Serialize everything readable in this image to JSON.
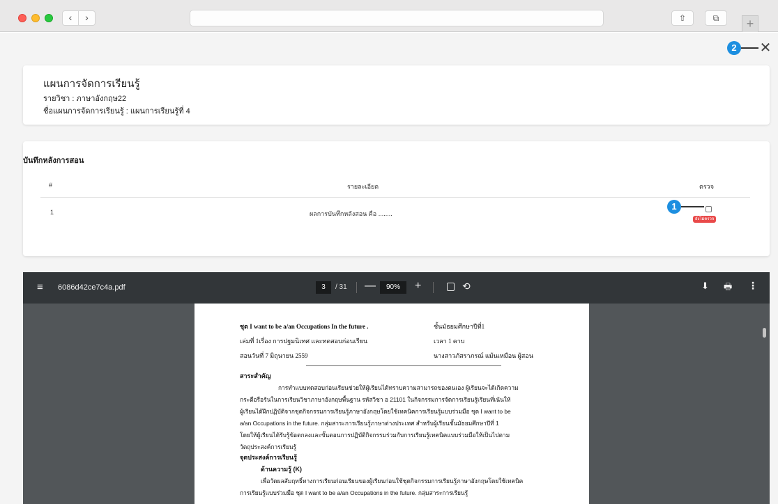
{
  "browser": {
    "url": "",
    "back_icon": "‹",
    "forward_icon": "›",
    "share_icon": "⇧",
    "tabs_icon": "⧉",
    "newtab_icon": "+"
  },
  "callouts": {
    "one": "1",
    "two": "2"
  },
  "close_icon": "✕",
  "plan_card": {
    "title": "แผนการจัดการเรียนรู้",
    "subject": "รายวิชา : ภาษาอังกฤษ22",
    "plan_name": "ชื่อแผนการจัดการเรียนรู้ : แผนการเรียนรู้ที่ 4"
  },
  "notes_card": {
    "title": "บันทึกหลังการสอน",
    "headers": {
      "no": "#",
      "detail": "รายละเอียด",
      "check": "ตรวจ"
    },
    "rows": [
      {
        "no": "1",
        "detail": "ผลการบันทึกหลังสอน คือ ........",
        "status": "ยังไม่ตรวจ"
      }
    ]
  },
  "pdf_viewer": {
    "menu_icon": "≡",
    "file_name": "6086d42ce7c4a.pdf",
    "current_page": "3",
    "total_pages": "/ 31",
    "minus": "—",
    "zoom": "90%",
    "plus": "+",
    "rotate_icon": "⟲",
    "download_icon": "⬇",
    "print_icon": "🖶",
    "more_icon": "⋮"
  },
  "document": {
    "header_left": [
      "ชุด I want to be a/an Occupations In the future .",
      "เล่มที่ 1เรื่อง การปฐมนิเทศ และทดสอบก่อนเรียน",
      "สอนวันที่ 7 มิถุนายน 2559"
    ],
    "header_right": [
      "ชั้นมัธยมศึกษาปีที่1",
      "เวลา 1 คาบ",
      "นางสาวภัสราภรณ์  แม้นเหมือน  ผู้สอน"
    ],
    "section1_title": "สาระสำคัญ",
    "section1_lines": [
      "การทำแบบทดสอบก่อนเรียนช่วยให้ผู้เรียนได้ทราบความสามารถของตนเอง  ผู้เรียนจะได้เกิดความ",
      "กระตือรือร้นในการเรียนวิชาภาษาอังกฤษพื้นฐาน รหัสวิชา อ 21101 ในกิจกรรมการจัดการเรียนรู้เรียนที่เน้นให้",
      "ผู้เรียนได้ฝึกปฏิบัติจากชุดกิจกรรมการเรียนรู้ภาษาอังกฤษโดยใช้เทคนิคการเรียนรู้แบบร่วมมือ ชุด I want to be",
      "a/an Occupations in the future. กลุ่มสาระการเรียนรู้ภาษาต่างประเทศ สำหรับผู้เรียนชั้นมัธยมศึกษาปีที่ 1",
      "โดยให้ผู้เรียนได้รับรู้ข้อตกลงและขั้นตอนการปฏิบัติกิจกรรมร่วมกับการเรียนรู้เทคนิคแบบร่วมมือให้เป็นไปตาม",
      "วัตถุประสงค์การเรียนรู้"
    ],
    "section2_title": "จุดประสงค์การเรียนรู้",
    "section2_sub": "ด้านความรู้ (K)",
    "section2_lines": [
      "เพื่อวัดผลสัมฤทธิ์ทางการเรียนก่อนเรียนของผู้เรียนก่อนใช้ชุดกิจกรรมการเรียนรู้ภาษาอังกฤษโดยใช้เทคนิค",
      "การเรียนรู้แบบร่วมมือ ชุด I  want  to  be  a/an  Occupations  in  the  future.  กลุ่มสาระการเรียนรู้"
    ]
  }
}
